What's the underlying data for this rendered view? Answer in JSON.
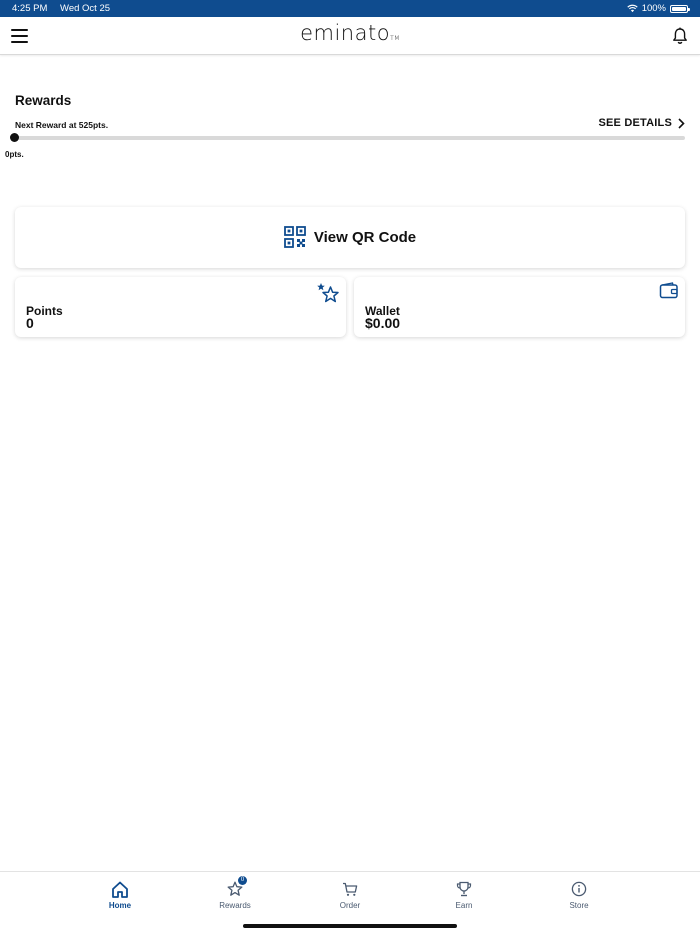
{
  "status_bar": {
    "time": "4:25 PM",
    "date": "Wed Oct 25",
    "battery": "100%",
    "icons": [
      "wifi-icon",
      "battery-icon"
    ]
  },
  "header": {
    "brand": "eminato",
    "brand_tm": "TM",
    "icons": [
      "menu-icon",
      "bell-icon"
    ]
  },
  "rewards": {
    "title": "Rewards",
    "next_reward": "Next Reward at 525pts.",
    "see_details": "SEE DETAILS",
    "progress_fraction": 0,
    "current_points_label": "0pts."
  },
  "qr": {
    "label": "View QR Code",
    "icon": "qr-code-icon"
  },
  "points_card": {
    "title": "Points",
    "value": "0",
    "icon": "star-icon"
  },
  "wallet_card": {
    "title": "Wallet",
    "value": "$0.00",
    "icon": "wallet-icon"
  },
  "tabs": [
    {
      "label": "Home",
      "icon": "home-icon",
      "active": true
    },
    {
      "label": "Rewards",
      "icon": "star-icon",
      "badge": "0"
    },
    {
      "label": "Order",
      "icon": "cart-icon"
    },
    {
      "label": "Earn",
      "icon": "trophy-icon"
    },
    {
      "label": "Store",
      "icon": "info-icon"
    }
  ],
  "colors": {
    "primary": "#0f4c8f",
    "progress_track": "#d9d9d9"
  }
}
